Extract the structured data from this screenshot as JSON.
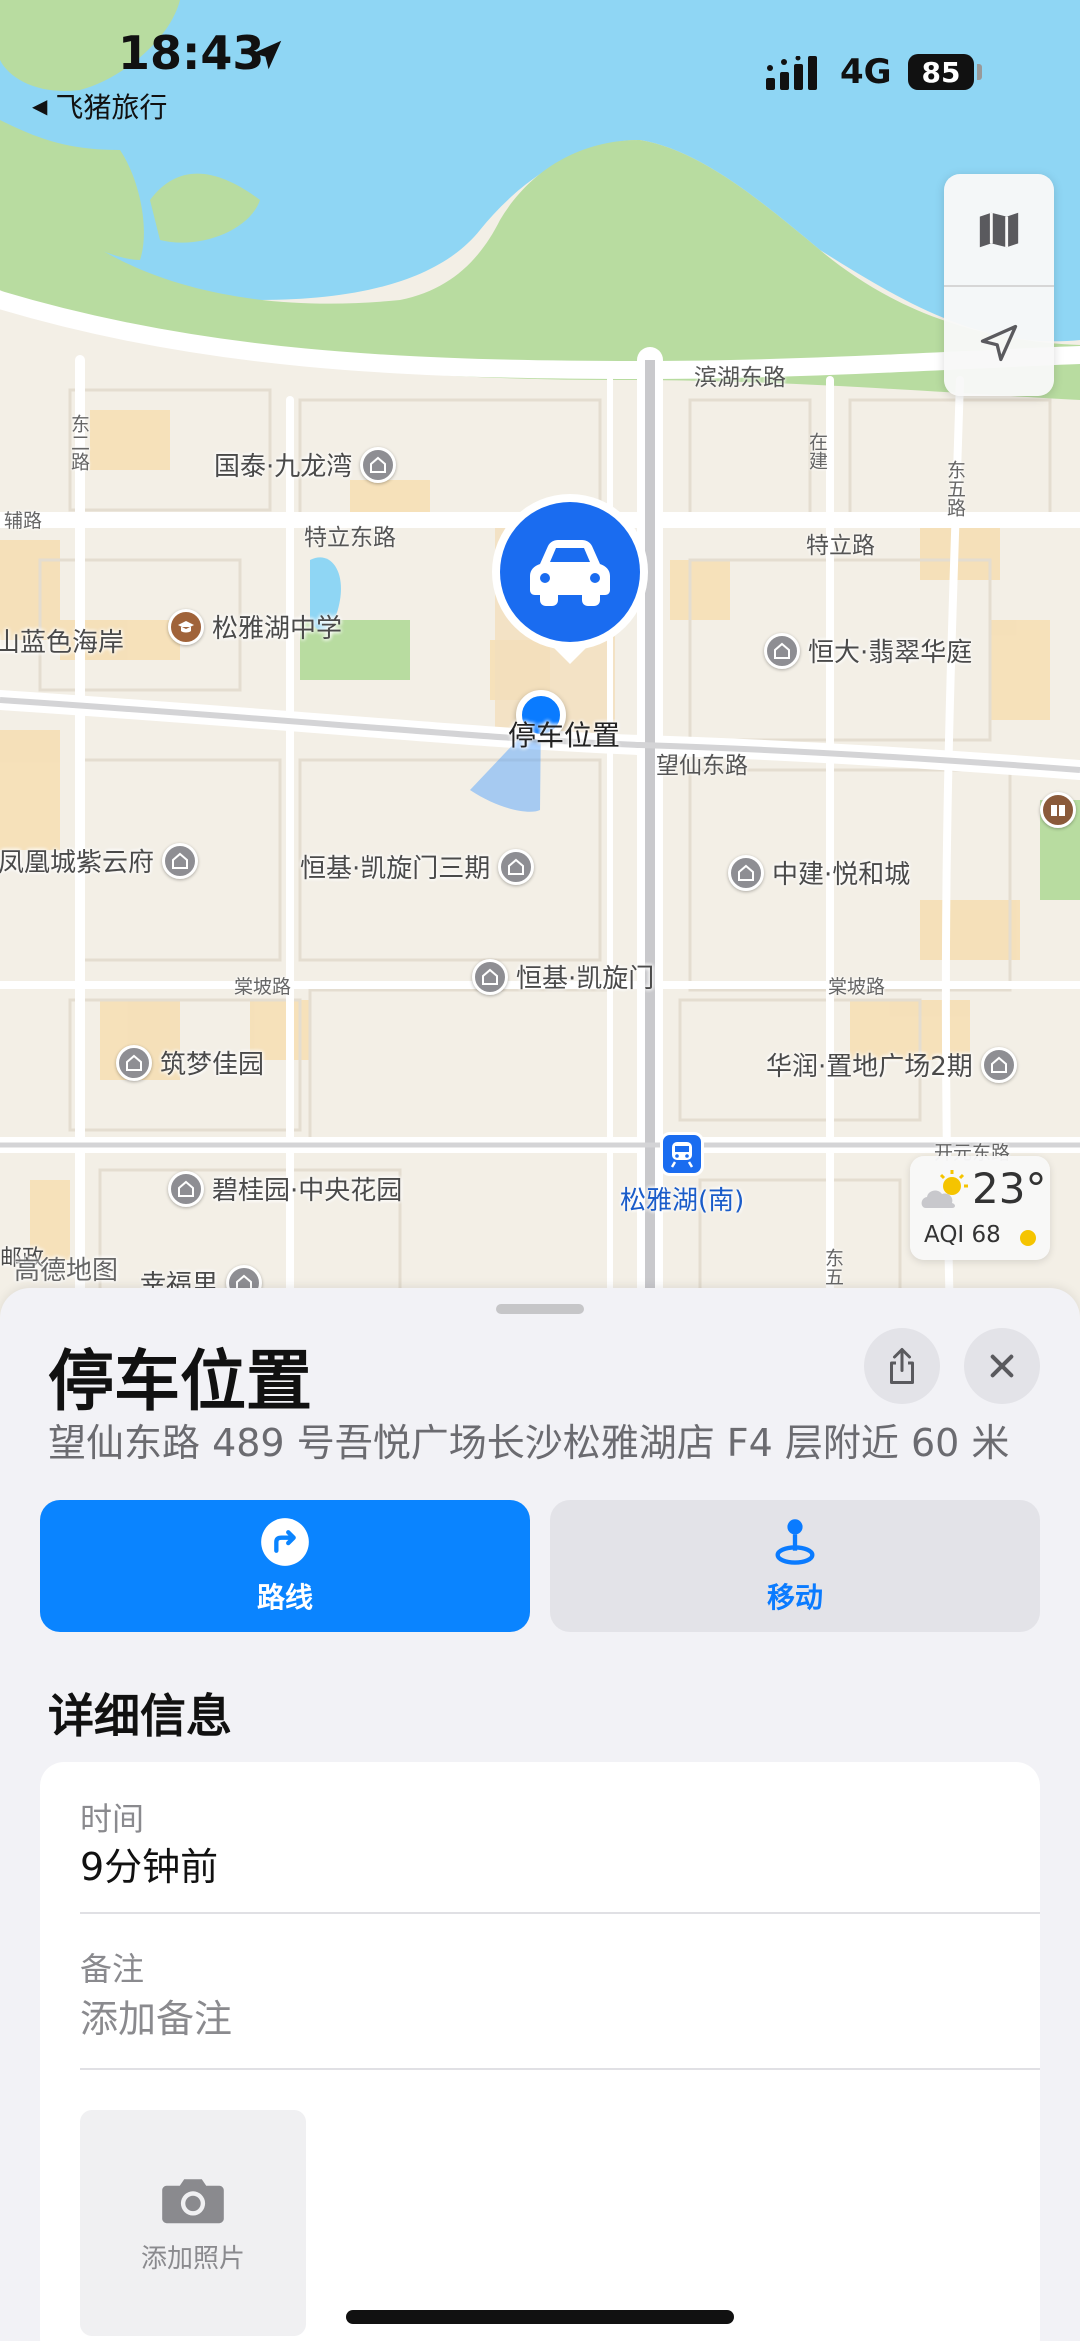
{
  "status_bar": {
    "time": "18:43",
    "back_app": "飞猪旅行",
    "network": "4G",
    "battery": "85"
  },
  "map": {
    "road_labels": {
      "binhu_east": "滨湖东路",
      "teli_east": "特立东路",
      "teli": "特立路",
      "wangxian_east": "望仙东路",
      "tangpo_left": "棠坡路",
      "tangpo_right": "棠坡路",
      "fulu": "辅路",
      "dong2": "东二路",
      "zaijian": "在建",
      "dong5": "东五路",
      "dong5b": "东五",
      "kaiyuan": "开元东路"
    },
    "places": {
      "guotai": "国泰·九龙湾",
      "songya_school": "松雅湖中学",
      "lanse": "山蓝色海岸",
      "hengda": "恒大·翡翠华庭",
      "fenghuang": "凤凰城紫云府",
      "kaixuan3": "恒基·凯旋门三期",
      "zhongjian": "中建·悦和城",
      "kaixuan": "恒基·凯旋门",
      "zhumeng": "筑梦佳园",
      "huarun": "华润·置地广场2期",
      "biguiyuan": "碧桂园·中央花园",
      "metro": "松雅湖(南)",
      "xingfu": "幸福里",
      "gaode": "高德地图",
      "youzheng": "邮政",
      "parking_pin": "停车位置"
    },
    "weather": {
      "temperature": "23°",
      "aqi": "AQI 68",
      "icon": "partly-cloudy-icon",
      "aqi_color": "#f5c400"
    }
  },
  "sheet": {
    "title": "停车位置",
    "address": "望仙东路 489 号吾悦广场长沙松雅湖店 F4 层附近 60 米",
    "route_label": "路线",
    "move_label": "移动",
    "details_title": "详细信息",
    "time_label": "时间",
    "time_value": "9分钟前",
    "note_label": "备注",
    "note_placeholder": "添加备注",
    "add_photo_label": "添加照片"
  },
  "colors": {
    "accent": "#0a84ff",
    "water": "#8fd6f4",
    "park": "#b8dca0"
  }
}
